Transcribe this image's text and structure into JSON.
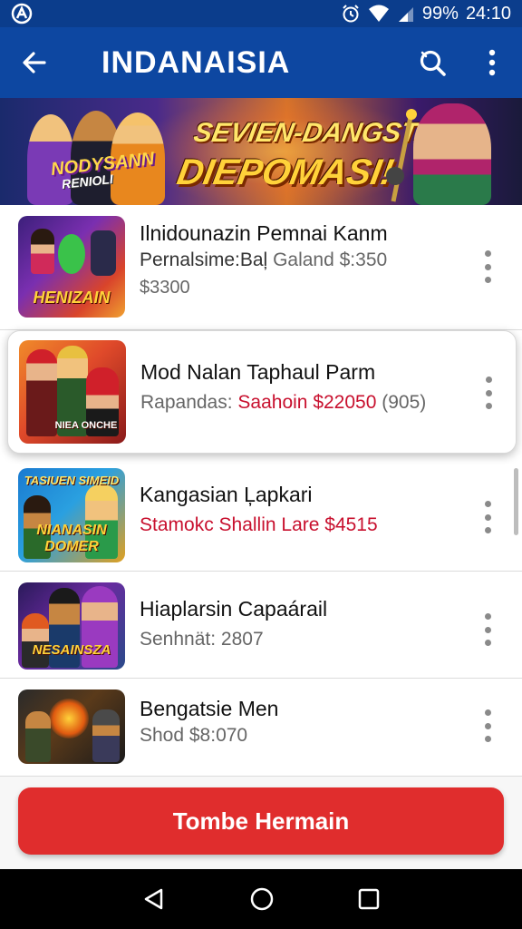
{
  "status_bar": {
    "battery": "99%",
    "time": "24:10"
  },
  "app_bar": {
    "title": "INDANAISIA"
  },
  "banner": {
    "left_text_1": "NODYSANN",
    "left_text_2": "RENIOLI",
    "headline_1": "SEVIEN-DANGSTA",
    "headline_2": "DIEPOMASI!"
  },
  "items": [
    {
      "title": "Ilnidounazin Pemnai Kanm",
      "line2": "Pernalsime:Baļ",
      "line2_grey": "Galand $:350",
      "line3": "$3300",
      "thumb_caption": "HENIZAIN"
    },
    {
      "title": "Mod Nalan Taphaul Parm",
      "line2_grey": "Rapandas:",
      "line2_red": "Saahoin $22050",
      "line2_tail": "(905)",
      "thumb_caption": "NIEA ONCHE"
    },
    {
      "title": "Kangasian Ļapkari",
      "line2_red": "Stamokc Shallin Lare $4515",
      "thumb_caption": "NIANASIN DOMER",
      "thumb_caption_top": "TASIUEN SIMEID"
    },
    {
      "title": "Hiaplarsin Capaárail",
      "line2": "Senhnät: 2807",
      "thumb_caption": "NESAINSZA"
    },
    {
      "title": "Bengatsie Men",
      "line2": "Shod $8:070",
      "thumb_caption": ""
    }
  ],
  "cta": {
    "label": "Tombe Hermain"
  },
  "colors": {
    "app_bar": "#0d47a1",
    "status_bar": "#0b3d8c",
    "cta": "#e02d2d",
    "price_red": "#c8102e"
  }
}
